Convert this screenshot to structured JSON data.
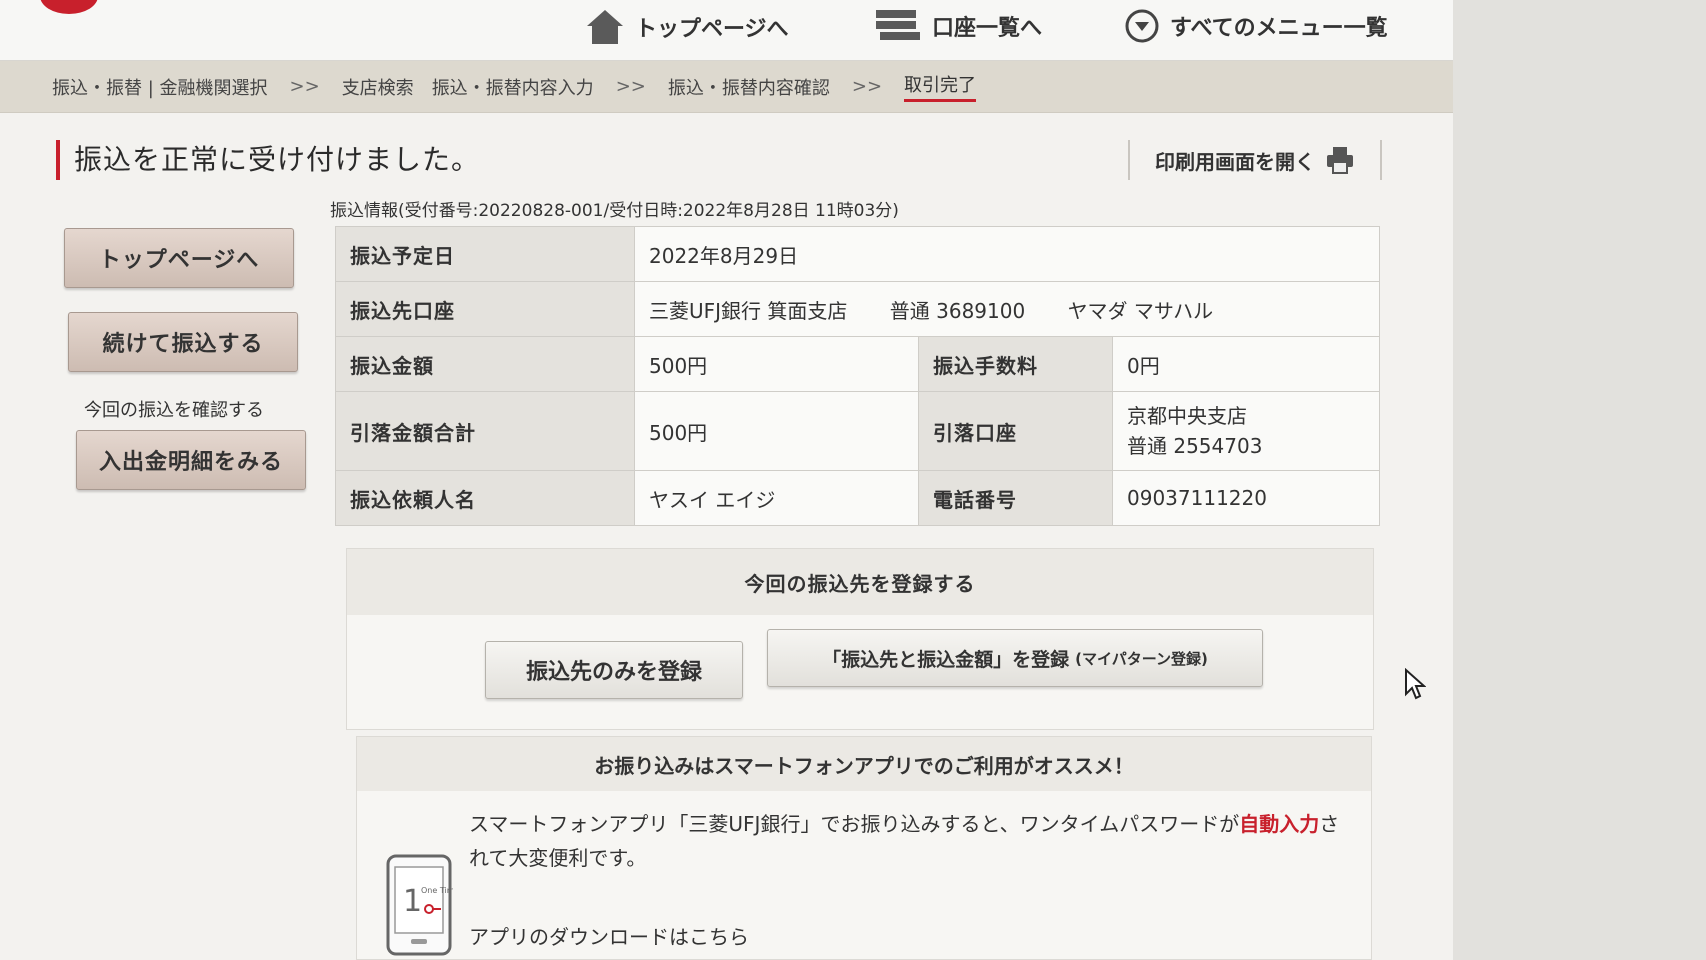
{
  "header": {
    "nav": [
      {
        "label": "トップページへ",
        "icon": "home-icon"
      },
      {
        "label": "口座一覧へ",
        "icon": "account-list-icon"
      },
      {
        "label": "すべてのメニュー一覧",
        "icon": "chevron-down-circle-icon"
      }
    ],
    "brand_color": "#c8202c"
  },
  "breadcrumb": {
    "items": [
      "振込・振替 | 金融機関選択",
      "支店検索",
      "振込・振替内容入力",
      "振込・振替内容確認",
      "取引完了"
    ],
    "separator": ">>"
  },
  "page_title": "振込を正常に受け付けました。",
  "print_link": "印刷用画面を開く",
  "left_actions": {
    "top_button": "トップページへ",
    "continue_button": "続けて振込する",
    "confirm_note": "今回の振込を確認する",
    "statement_button": "入出金明細をみる"
  },
  "info": {
    "caption": "振込情報(受付番号:20220828-001/受付日時:2022年8月28日 11時03分)",
    "date_label": "振込予定日",
    "date_value": "2022年8月29日",
    "dest_label": "振込先口座",
    "dest_bank": "三菱UFJ銀行 箕面支店",
    "dest_account": "普通 3689100",
    "dest_name": "ヤマダ マサハル",
    "amount_label": "振込金額",
    "amount_value": "500円",
    "fee_label": "振込手数料",
    "fee_value": "0円",
    "total_label": "引落金額合計",
    "total_value": "500円",
    "debit_label": "引落口座",
    "debit_branch": "京都中央支店",
    "debit_account": "普通 2554703",
    "requester_label": "振込依頼人名",
    "requester_value": "ヤスイ エイジ",
    "phone_label": "電話番号",
    "phone_value": "09037111220"
  },
  "register": {
    "title": "今回の振込先を登録する",
    "dest_only_button": "振込先のみを登録",
    "dest_amount_button": "「振込先と振込金額」を登録",
    "dest_amount_button_note": "(マイパターン登録)"
  },
  "promo": {
    "title": "お振り込みはスマートフォンアプリでのご利用がオススメ！",
    "text_before": "スマートフォンアプリ「三菱UFJ銀行」でお振り込みすると、ワンタイムパスワードが",
    "text_highlight": "自動入力",
    "text_after": "されて大変便利です。",
    "download_link": "アプリのダウンロードはこちら",
    "phone_icon_text": "One Time"
  }
}
